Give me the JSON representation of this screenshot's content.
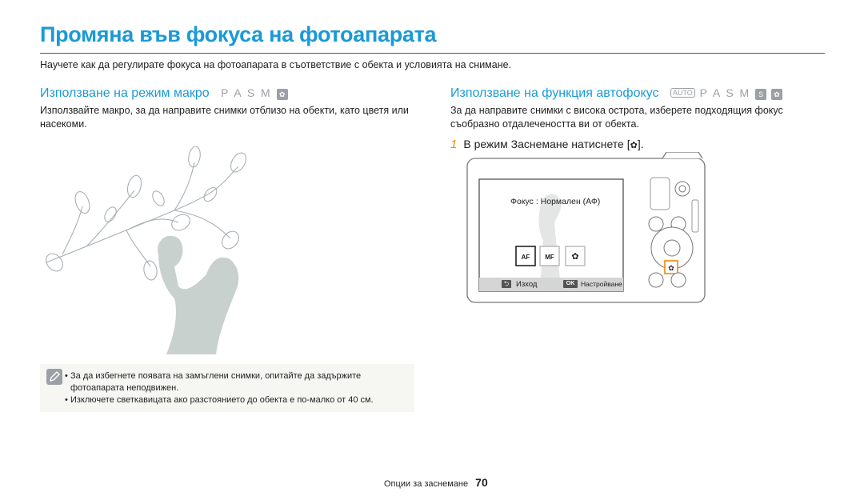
{
  "page": {
    "title": "Промяна във фокуса на фотоапарата",
    "intro": "Научете как да регулирате фокуса на фотоапарата в съответствие с обекта и условията на снимане."
  },
  "macro": {
    "heading": "Използване на режим макро",
    "modes_text": "P A S M",
    "body": "Използвайте макро, за да направите снимки отблизо на обекти, като цветя или насекоми."
  },
  "af": {
    "heading": "Използване на функция автофокус",
    "auto_badge": "AUTO",
    "modes_text": "P A S M",
    "s_badge": "S",
    "body": "За да направите снимки с висока острота, изберете подходящия фокус съобразно отдалечеността ви от обекта.",
    "step_number": "1",
    "step_text": "В режим Заснемане натиснете [",
    "step_end": "]."
  },
  "camera": {
    "screen_label": "Фокус : Нормален (АФ)",
    "icon_af": "AF",
    "icon_mf": "MF",
    "back_label": "Изход",
    "ok_key": "OK",
    "ok_label": "Настройване"
  },
  "tips": {
    "items": [
      "За да избегнете появата на замъглени снимки, опитайте да задържите фотоапарата неподвижен.",
      "Изключете светкавицата ако разстоянието до обекта е по-малко от 40 см."
    ]
  },
  "footer": {
    "section": "Опции за заснемане",
    "page_number": "70"
  },
  "colors": {
    "accent": "#1a9ad6",
    "step_number": "#f08a00",
    "macro_highlight": "#f08a00",
    "mode_gray": "#9aa0a6"
  }
}
